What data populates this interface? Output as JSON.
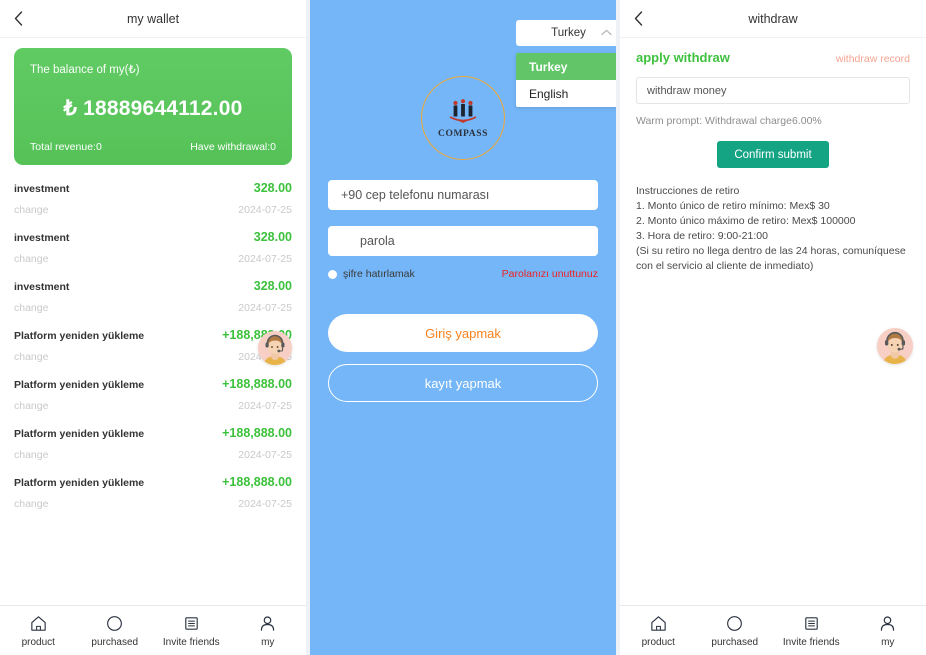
{
  "wallet": {
    "header": {
      "title": "my wallet",
      "back_icon": "chevron-left-icon"
    },
    "balance_card": {
      "label": "The balance of my(₺)",
      "amount": "₺ 18889644112.00",
      "total_revenue": "Total revenue:0",
      "have_withdrawal": "Have withdrawal:0"
    },
    "transactions": [
      {
        "name": "investment",
        "amount": "328.00",
        "sub": "change",
        "date": "2024-07-25"
      },
      {
        "name": "investment",
        "amount": "328.00",
        "sub": "change",
        "date": "2024-07-25"
      },
      {
        "name": "investment",
        "amount": "328.00",
        "sub": "change",
        "date": "2024-07-25"
      },
      {
        "name": "Platform yeniden yükleme",
        "amount": "+188,888.00",
        "sub": "change",
        "date": "2024-07-25"
      },
      {
        "name": "Platform yeniden yükleme",
        "amount": "+188,888.00",
        "sub": "change",
        "date": "2024-07-25"
      },
      {
        "name": "Platform yeniden yükleme",
        "amount": "+188,888.00",
        "sub": "change",
        "date": "2024-07-25"
      },
      {
        "name": "Platform yeniden yükleme",
        "amount": "+188,888.00",
        "sub": "change",
        "date": "2024-07-25"
      }
    ],
    "tabbar": [
      {
        "icon": "home-icon",
        "label": "product"
      },
      {
        "icon": "circle-icon",
        "label": "purchased"
      },
      {
        "icon": "list-icon",
        "label": "Invite friends"
      },
      {
        "icon": "person-icon",
        "label": "my"
      }
    ],
    "support_avatar": "customer-service-avatar"
  },
  "login": {
    "language": {
      "selected": "Turkey",
      "caret_icon": "chevron-up-icon",
      "options": [
        {
          "label": "Turkey",
          "selected": true
        },
        {
          "label": "English",
          "selected": false
        }
      ]
    },
    "logo": {
      "name": "compass-logo",
      "text": "COMPASS"
    },
    "phone": {
      "value": "+90 cep telefonu numarası",
      "placeholder": "cep telefonu numarası"
    },
    "password": {
      "value": "parola",
      "placeholder": "parola"
    },
    "remember_label": "şifre hatırlamak",
    "forgot_label": "Parolanızı unuttunuz",
    "login_button": "Giriş yapmak",
    "register_button": "kayıt yapmak"
  },
  "withdraw": {
    "header": {
      "title": "withdraw",
      "back_icon": "chevron-left-icon"
    },
    "apply_title": "apply withdraw",
    "record_link": "withdraw record",
    "amount_field": {
      "value": "withdraw money",
      "placeholder": "withdraw money"
    },
    "warm_prompt": "Warm prompt:  Withdrawal charge6.00%",
    "confirm_button": "Confirm submit",
    "instructions_title": "Instrucciones de retiro",
    "instructions": [
      "1. Monto único de retiro mínimo: Mex$ 30",
      "2. Monto único máximo de retiro: Mex$ 100000",
      "3. Hora de retiro: 9:00-21:00",
      "(Si su retiro no llega dentro de las 24 horas, comuníquese",
      "con el servicio al cliente de inmediato)"
    ],
    "tabbar": [
      {
        "icon": "home-icon",
        "label": "product"
      },
      {
        "icon": "circle-icon",
        "label": "purchased"
      },
      {
        "icon": "list-icon",
        "label": "Invite friends"
      },
      {
        "icon": "person-icon",
        "label": "my"
      }
    ],
    "support_avatar": "customer-service-avatar"
  },
  "colors": {
    "green": "#55c258",
    "blue": "#74b6f7",
    "teal": "#14a383",
    "orange": "#f8821e",
    "red": "#ef2222",
    "salmon": "#f5a492",
    "page_bg": "#eef1f6"
  }
}
